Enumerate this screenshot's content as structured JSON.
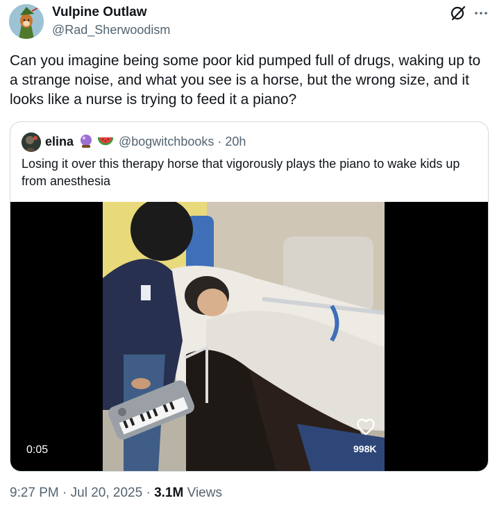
{
  "author": {
    "display_name": "Vulpine Outlaw",
    "handle": "@Rad_Sherwoodism",
    "avatar_icon": "robin-hood-fox-avatar"
  },
  "header_actions": {
    "grok_icon": "grok-icon",
    "more_icon": "more-options-icon"
  },
  "tweet": {
    "text": "Can you imagine being some poor kid pumped full of drugs, waking up to a strange noise, and what you see is a horse, but the wrong size, and it looks like a nurse is trying to feed it a piano?"
  },
  "quote": {
    "display_name": "elina",
    "emoji_1": "crystal-ball-emoji",
    "emoji_2": "watermelon-emoji",
    "handle": "@bogwitchbooks",
    "separator": "·",
    "age": "20h",
    "text": "Losing it over this therapy horse that vigorously plays the piano to wake kids up from anesthesia",
    "video": {
      "timestamp": "0:05",
      "likes": "998K",
      "heart_icon": "heart-outline-icon"
    }
  },
  "footer": {
    "time": "9:27 PM",
    "sep1": "·",
    "date": "Jul 20, 2025",
    "sep2": "·",
    "views_count": "3.1M",
    "views_label": "Views"
  },
  "colors": {
    "text_primary": "#0f1419",
    "text_secondary": "#536471",
    "border": "#cfd9de",
    "video_bg": "#000000"
  }
}
